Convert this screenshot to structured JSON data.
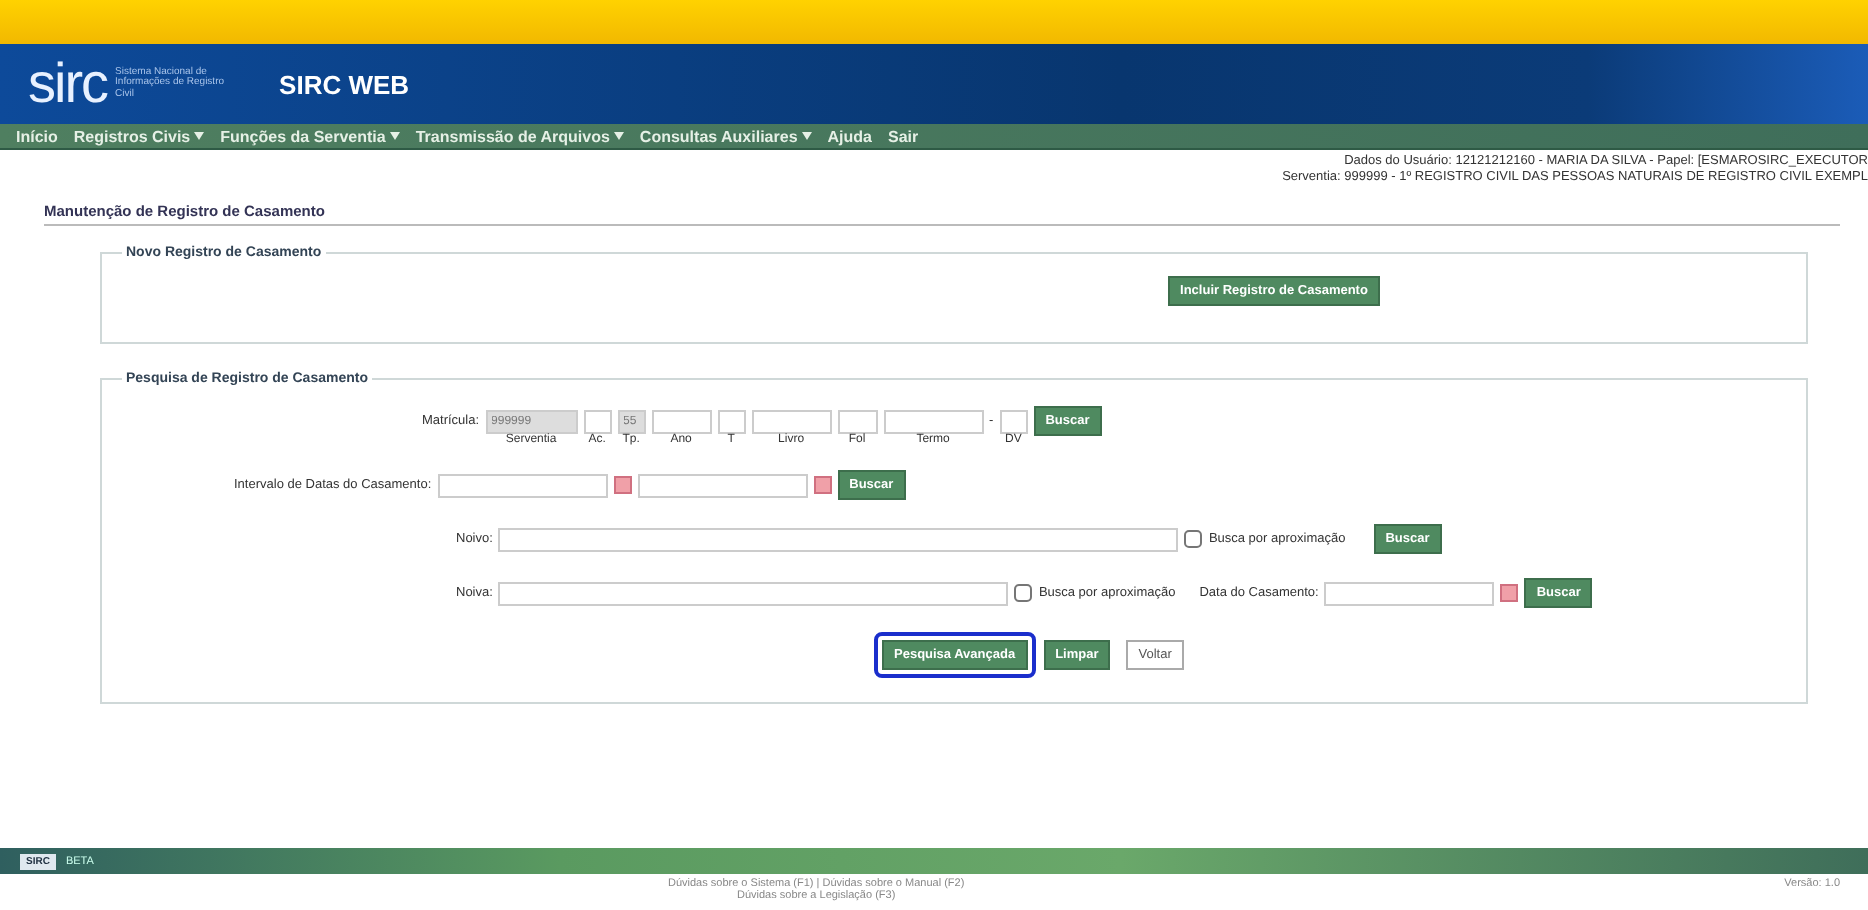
{
  "header": {
    "logo": "sirc",
    "logo_subtitle": "Sistema Nacional de Informações de Registro Civil",
    "title": "SIRC WEB"
  },
  "menu": [
    {
      "label": "Início",
      "dropdown": false
    },
    {
      "label": "Registros Civis",
      "dropdown": true
    },
    {
      "label": "Funções da Serventia",
      "dropdown": true
    },
    {
      "label": "Transmissão de Arquivos",
      "dropdown": true
    },
    {
      "label": "Consultas Auxiliares",
      "dropdown": true
    },
    {
      "label": "Ajuda",
      "dropdown": false
    },
    {
      "label": "Sair",
      "dropdown": false
    }
  ],
  "user_info": [
    "Dados do Usuário: 12121212160 - MARIA DA SILVA - Papel: [ESMAROSIRC_EXECUTOR",
    "Serventia: 999999 - 1º REGISTRO CIVIL DAS PESSOAS NATURAIS DE REGISTRO CIVIL EXEMPL"
  ],
  "page_title": "Manutenção de Registro de Casamento",
  "new_section": {
    "legend": "Novo Registro de Casamento",
    "button": "Incluir Registro de Casamento"
  },
  "search_section": {
    "legend": "Pesquisa de Registro de Casamento",
    "matricula": {
      "label": "Matrícula:",
      "parts": [
        {
          "caption": "Serventia",
          "value": "999999",
          "disabled": true
        },
        {
          "caption": "Ac.",
          "disabled": false
        },
        {
          "caption": "Tp.",
          "value": "55",
          "disabled": true
        },
        {
          "caption": "Ano",
          "disabled": false
        },
        {
          "caption": "T",
          "disabled": false
        },
        {
          "caption": "Livro",
          "disabled": false
        },
        {
          "caption": "Fol",
          "disabled": false
        },
        {
          "caption": "Termo",
          "disabled": false
        },
        {
          "caption": "DV",
          "disabled": false
        }
      ],
      "separator": "-",
      "button": "Buscar"
    },
    "date_range": {
      "label": "Intervalo de Datas do Casamento:",
      "button": "Buscar"
    },
    "groom": {
      "label": "Noivo:",
      "checkbox": "Busca por aproximação",
      "checked": false,
      "button": "Buscar"
    },
    "bride": {
      "label": "Noiva:",
      "checkbox": "Busca por aproximação",
      "checked": false,
      "date_label": "Data do Casamento:",
      "button": "Buscar"
    },
    "actions": [
      {
        "label": "Pesquisa Avançada",
        "kind": "primary",
        "focused": true
      },
      {
        "label": "Limpar",
        "kind": "primary",
        "focused": false
      },
      {
        "label": "Voltar",
        "kind": "secondary",
        "focused": false
      }
    ]
  },
  "footer": {
    "badge": "SIRC",
    "version_label": "BETA",
    "links": [
      "Dúvidas sobre o Sistema (F1) | Dúvidas sobre o Manual (F2)",
      "Dúvidas sobre a Legislação (F3)"
    ],
    "version": "Versão: 1.0"
  }
}
